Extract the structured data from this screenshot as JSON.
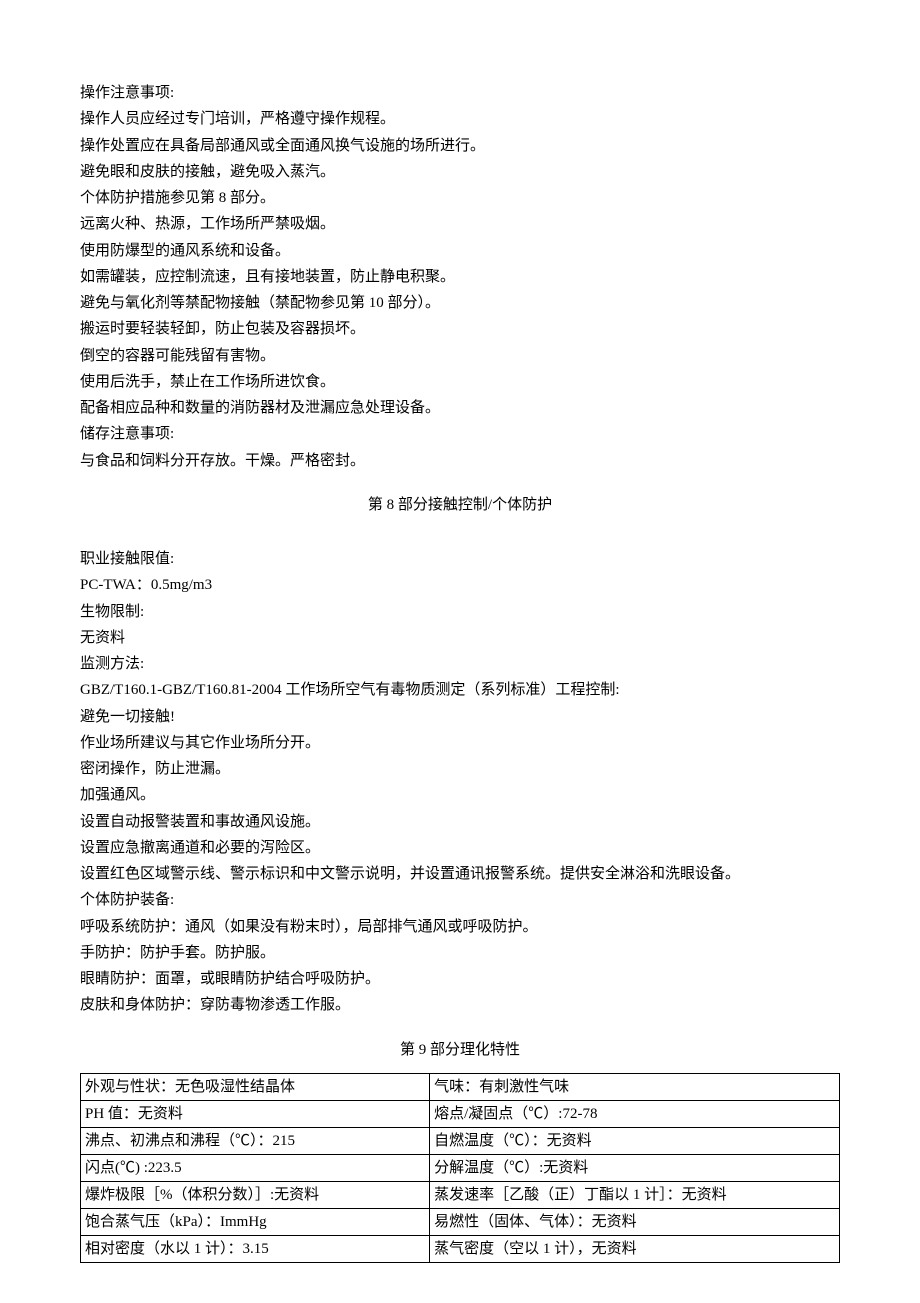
{
  "paragraphs_top": [
    "操作注意事项:",
    "操作人员应经过专门培训，严格遵守操作规程。",
    "操作处置应在具备局部通风或全面通风换气设施的场所进行。",
    "避免眼和皮肤的接触，避免吸入蒸汽。",
    "个体防护措施参见第 8 部分。",
    "远离火种、热源，工作场所严禁吸烟。",
    "使用防爆型的通风系统和设备。",
    "如需罐装，应控制流速，且有接地装置，防止静电积聚。",
    "避免与氧化剂等禁配物接触（禁配物参见第 10 部分）。",
    "搬运时要轻装轻卸，防止包装及容器损坏。",
    "倒空的容器可能残留有害物。",
    "使用后洗手，禁止在工作场所进饮食。",
    "配备相应品种和数量的消防器材及泄漏应急处理设备。",
    "储存注意事项:",
    "与食品和饲料分开存放。干燥。严格密封。"
  ],
  "section8_title": "第 8 部分接触控制/个体防护",
  "section8_paragraphs": [
    "职业接触限值:",
    "PC-TWA：0.5mg/m3",
    "生物限制:",
    "无资料",
    "监测方法:",
    "GBZ/T160.1-GBZ/T160.81-2004 工作场所空气有毒物质测定（系列标准）工程控制:",
    "避免一切接触!",
    "作业场所建议与其它作业场所分开。",
    "密闭操作，防止泄漏。",
    "加强通风。",
    "设置自动报警装置和事故通风设施。",
    "设置应急撤离通道和必要的泻险区。",
    "设置红色区域警示线、警示标识和中文警示说明，并设置通讯报警系统。提供安全淋浴和洗眼设备。",
    "个体防护装备:",
    "呼吸系统防护：通风（如果没有粉末时），局部排气通风或呼吸防护。",
    "手防护：防护手套。防护服。",
    "眼睛防护：面罩，或眼睛防护结合呼吸防护。",
    "皮肤和身体防护：穿防毒物渗透工作服。"
  ],
  "section9_title": "第 9 部分理化特性",
  "table_rows": [
    {
      "left": "外观与性状：无色吸湿性结晶体",
      "right": "气味：有刺激性气味"
    },
    {
      "left": "PH 值：无资料",
      "right": "熔点/凝固点（℃）:72-78"
    },
    {
      "left": "沸点、初沸点和沸程（℃）：215",
      "right": "自燃温度（℃）：无资料"
    },
    {
      "left": "闪点(℃) :223.5",
      "right": "分解温度（℃）:无资料"
    },
    {
      "left": "爆炸极限［%（体积分数）］:无资料",
      "right": "蒸发速率［乙酸（正）丁酯以 1 计］：无资料"
    },
    {
      "left": "饱合蒸气压（kPa）：ImmHg",
      "right": "易燃性（固体、气体）：无资料"
    },
    {
      "left": "相对密度（水以 1 计）：3.15",
      "right": "蒸气密度（空以 1 计），无资料"
    }
  ]
}
